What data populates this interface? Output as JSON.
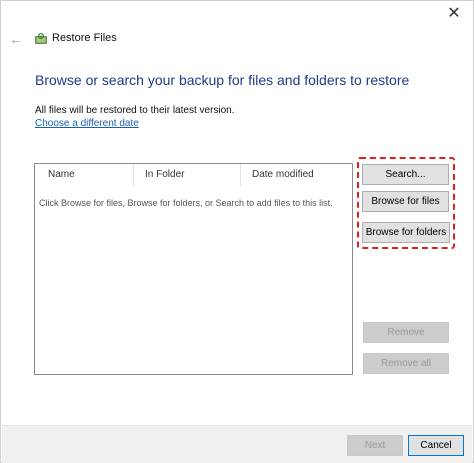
{
  "window": {
    "title": "Restore Files",
    "close_glyph": "✕",
    "back_glyph": "←"
  },
  "main": {
    "heading": "Browse or search your backup for files and folders to restore",
    "info": "All files will be restored to their latest version.",
    "link": "Choose a different date"
  },
  "file_list": {
    "columns": [
      "Name",
      "In Folder",
      "Date modified"
    ],
    "empty_hint": "Click Browse for files, Browse for folders, or Search to add files to this list."
  },
  "side_buttons": {
    "search": "Search...",
    "browse_files": "Browse for files",
    "browse_folders": "Browse for folders",
    "remove": "Remove",
    "remove_all": "Remove all"
  },
  "footer": {
    "next": "Next",
    "cancel": "Cancel"
  },
  "colors": {
    "heading": "#1e3a8a",
    "link": "#1a5fb4",
    "highlight": "#e02020"
  },
  "icons": {
    "title_icon": "backup-restore-icon",
    "back": "back-arrow-icon",
    "close": "close-icon"
  }
}
